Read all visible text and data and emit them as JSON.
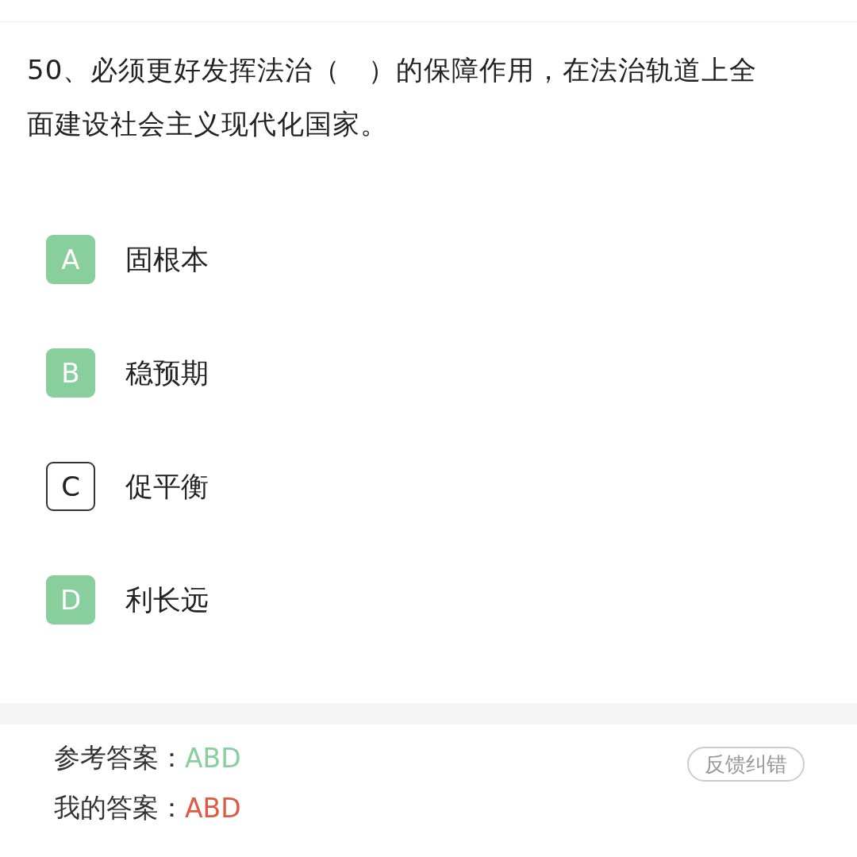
{
  "question": {
    "text": "50、必须更好发挥法治（　）的保障作用，在法治轨道上全面建设社会主义现代化国家。"
  },
  "options": [
    {
      "letter": "A",
      "text": "固根本",
      "selected": true
    },
    {
      "letter": "B",
      "text": "稳预期",
      "selected": true
    },
    {
      "letter": "C",
      "text": "促平衡",
      "selected": false
    },
    {
      "letter": "D",
      "text": "利长远",
      "selected": true
    }
  ],
  "answers": {
    "reference_label": "参考答案：",
    "reference_value": "ABD",
    "mine_label": "我的答案：",
    "mine_value": "ABD"
  },
  "feedback_button": "反馈纠错"
}
